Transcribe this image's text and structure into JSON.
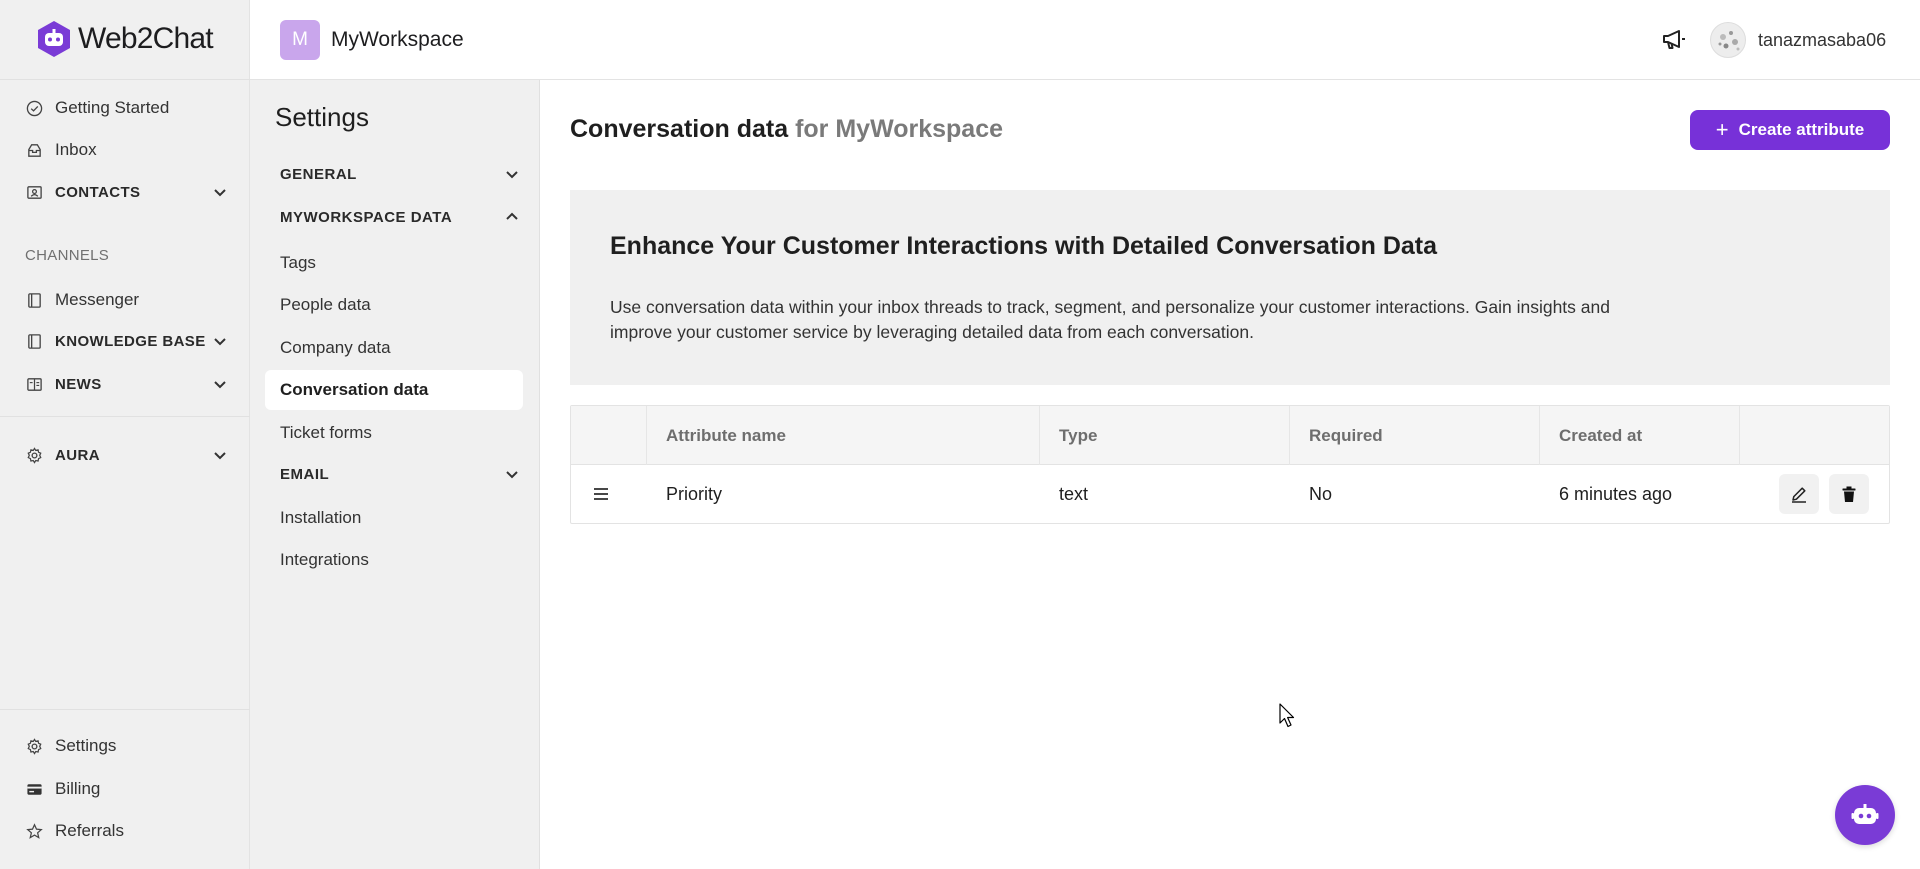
{
  "brand": {
    "name": "Web2Chat",
    "accent": "#7731d8"
  },
  "sidebar": {
    "items": [
      {
        "label": "Getting Started",
        "icon": "check-circle-icon"
      },
      {
        "label": "Inbox",
        "icon": "inbox-icon"
      },
      {
        "label": "CONTACTS",
        "icon": "contacts-icon"
      }
    ],
    "channels_label": "CHANNELS",
    "channels": [
      {
        "label": "Messenger",
        "icon": "book-icon"
      },
      {
        "label": "KNOWLEDGE BASE",
        "icon": "book-icon"
      },
      {
        "label": "NEWS",
        "icon": "news-icon"
      }
    ],
    "aura": {
      "label": "AURA",
      "icon": "gear-icon"
    },
    "bottom": [
      {
        "label": "Settings",
        "icon": "gear-icon"
      },
      {
        "label": "Billing",
        "icon": "credit-card-icon"
      },
      {
        "label": "Referrals",
        "icon": "star-icon"
      }
    ]
  },
  "workspace": {
    "initial": "M",
    "name": "MyWorkspace"
  },
  "settings": {
    "title": "Settings",
    "groups": {
      "general": "GENERAL",
      "workspace_data": "MYWORKSPACE DATA",
      "email": "EMAIL"
    },
    "items": {
      "tags": "Tags",
      "people_data": "People data",
      "company_data": "Company data",
      "conversation_data": "Conversation data",
      "ticket_forms": "Ticket forms",
      "installation": "Installation",
      "integrations": "Integrations"
    }
  },
  "user": {
    "name": "tanazmasaba06"
  },
  "main": {
    "title": "Conversation data",
    "title_suffix": "for MyWorkspace",
    "create_button": "Create attribute",
    "banner": {
      "heading": "Enhance Your Customer Interactions with Detailed Conversation Data",
      "body": "Use conversation data within your inbox threads to track, segment, and personalize your customer interactions. Gain insights and improve your customer service by leveraging detailed data from each conversation."
    },
    "table": {
      "columns": [
        "Attribute name",
        "Type",
        "Required",
        "Created at"
      ],
      "rows": [
        {
          "name": "Priority",
          "type": "text",
          "required": "No",
          "created": "6 minutes ago"
        }
      ]
    }
  }
}
